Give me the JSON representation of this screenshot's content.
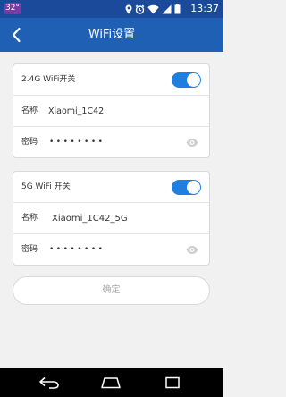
{
  "status_bar": {
    "temperature": "32°",
    "time": "13:37"
  },
  "header": {
    "title": "WiFi设置"
  },
  "wifi_24g": {
    "switch_label": "2.4G WiFi开关",
    "switch_on": true,
    "name_label": "名称",
    "name_value": "Xiaomi_1C42",
    "password_label": "密码",
    "password_mask": "••••••••"
  },
  "wifi_5g": {
    "switch_label": "5G WiFi 开关",
    "switch_on": true,
    "name_label": "名称",
    "name_value": "Xiaomi_1C42_5G",
    "password_label": "密码",
    "password_mask": "••••••••"
  },
  "confirm_button": {
    "label": "确定"
  },
  "colors": {
    "status_bar": "#1a4a99",
    "app_bar": "#1f60b5",
    "toggle_on": "#1f7fe0",
    "background": "#f1f1f1"
  },
  "icons": [
    "back-arrow-icon",
    "location-icon",
    "alarm-icon",
    "wifi-icon",
    "signal-icon",
    "battery-icon",
    "eye-icon",
    "nav-back-icon",
    "nav-home-icon",
    "nav-recents-icon"
  ]
}
